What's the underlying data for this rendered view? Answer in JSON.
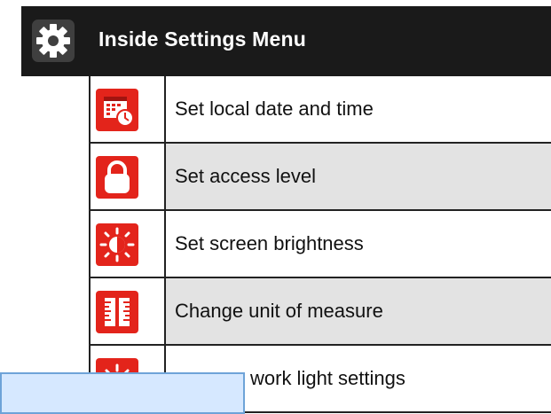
{
  "header": {
    "title": "Inside Settings Menu",
    "icon": "gear-icon"
  },
  "menu": {
    "items": [
      {
        "label": "Set local date and time",
        "icon": "calendar-clock-icon"
      },
      {
        "label": "Set access level",
        "icon": "lock-icon"
      },
      {
        "label": "Set screen brightness",
        "icon": "brightness-icon"
      },
      {
        "label": "Change unit of measure",
        "icon": "ruler-icon"
      },
      {
        "label": "work light settings",
        "icon": "work-light-icon"
      }
    ]
  },
  "colors": {
    "header_bg": "#1a1a1a",
    "icon_red": "#e3241b",
    "row_shaded": "#e3e3e3",
    "overlay_fill": "#d6e8ff",
    "overlay_border": "#6ea3d8"
  }
}
